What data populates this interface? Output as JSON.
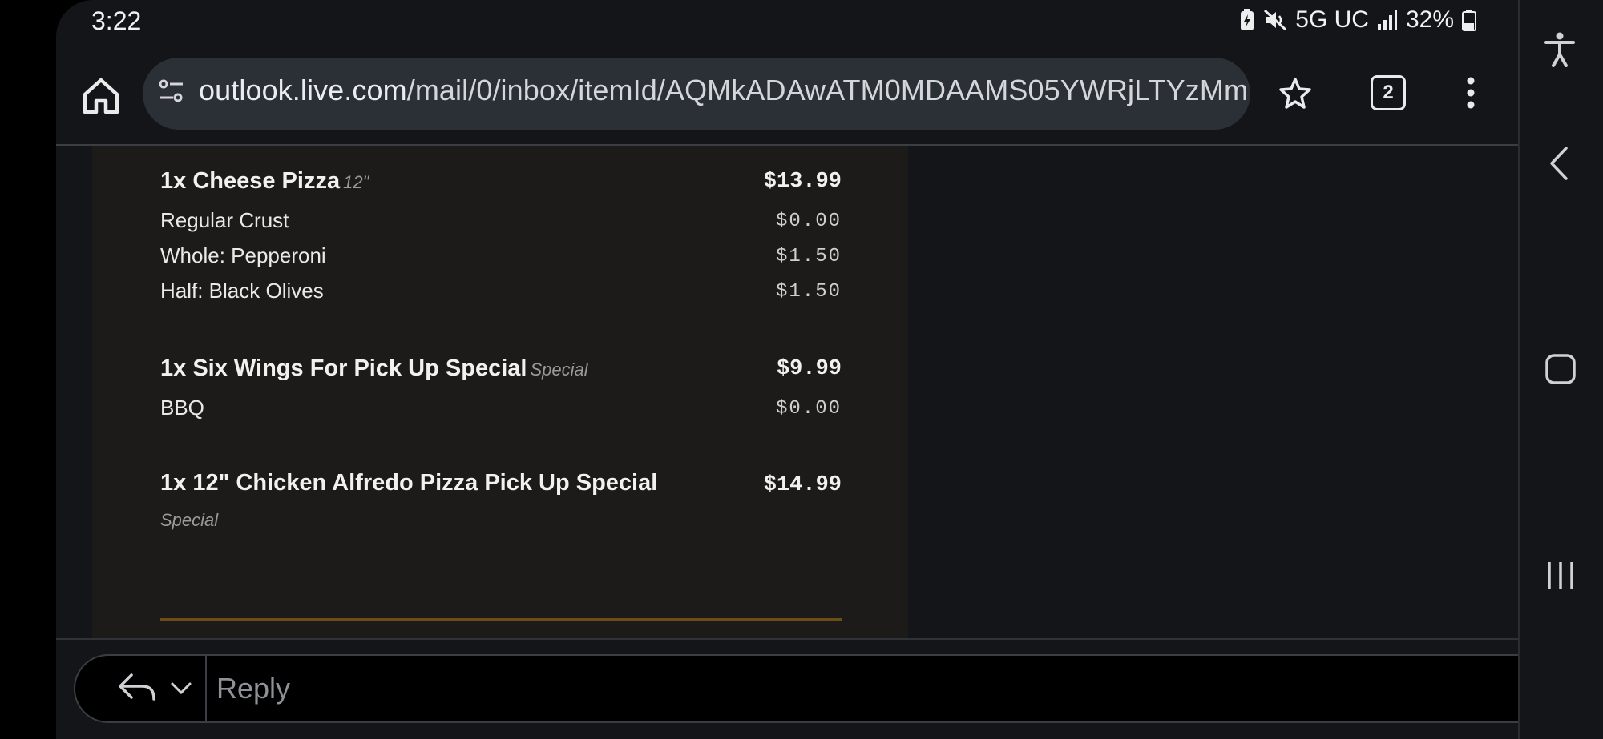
{
  "status_bar": {
    "time": "3:22",
    "network": "5G UC",
    "battery": "32%"
  },
  "browser": {
    "url_host": "outlook.live.com",
    "url_path": "/mail/0/inbox/itemId/AQMkADAwATM0MDAAMS05YWRjLTYzMm",
    "tab_count": "2"
  },
  "receipt": {
    "items": [
      {
        "title": "1x Cheese Pizza",
        "tag": "12\"",
        "price": "$13.99",
        "modifiers": [
          {
            "label": "Regular Crust",
            "price": "$0.00"
          },
          {
            "label": "Whole: Pepperoni",
            "price": "$1.50"
          },
          {
            "label": "Half: Black Olives",
            "price": "$1.50"
          }
        ]
      },
      {
        "title": "1x Six Wings For Pick Up Special",
        "tag": "Special",
        "price": "$9.99",
        "modifiers": [
          {
            "label": "BBQ",
            "price": "$0.00"
          }
        ]
      },
      {
        "title": "1x 12\" Chicken Alfredo Pizza Pick Up Special",
        "tag": "Special",
        "price": "$14.99",
        "modifiers": []
      }
    ]
  },
  "reply": {
    "placeholder": "Reply"
  },
  "colors": {
    "background": "#141518",
    "receipt_bg": "#1c1b19",
    "rule": "#6b4e17",
    "text": "#f1f1f1"
  }
}
